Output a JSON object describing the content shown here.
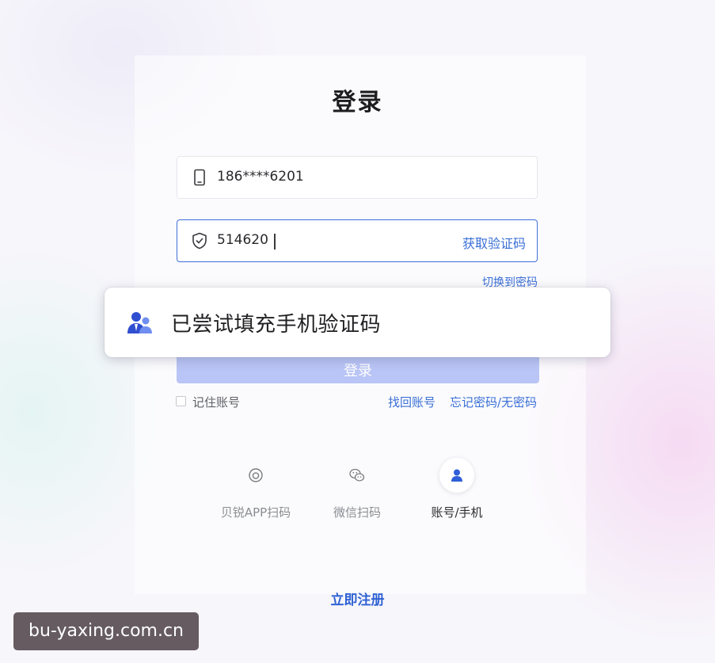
{
  "login": {
    "title": "登录",
    "phone_value": "186****6201",
    "code_value": "514620",
    "get_code_label": "获取验证码",
    "switch_to_password_label": "切换到密码",
    "login_button_label": "登录",
    "remember_label": "记住账号",
    "find_account_label": "找回账号",
    "forgot_password_label": "忘记密码/无密码",
    "register_label": "立即注册"
  },
  "toast": {
    "message": "已尝试填充手机验证码",
    "icon": "user-autofill-icon"
  },
  "methods": [
    {
      "label": "贝锐APP扫码",
      "icon": "app-scan-icon",
      "active": false
    },
    {
      "label": "微信扫码",
      "icon": "wechat-icon",
      "active": false
    },
    {
      "label": "账号/手机",
      "icon": "user-icon",
      "active": true
    }
  ],
  "watermark": "bu-yaxing.com.cn",
  "colors": {
    "accent": "#3a6fd6",
    "login_button": "#b9c5f6",
    "toast_icon": "#2f4fd0"
  }
}
